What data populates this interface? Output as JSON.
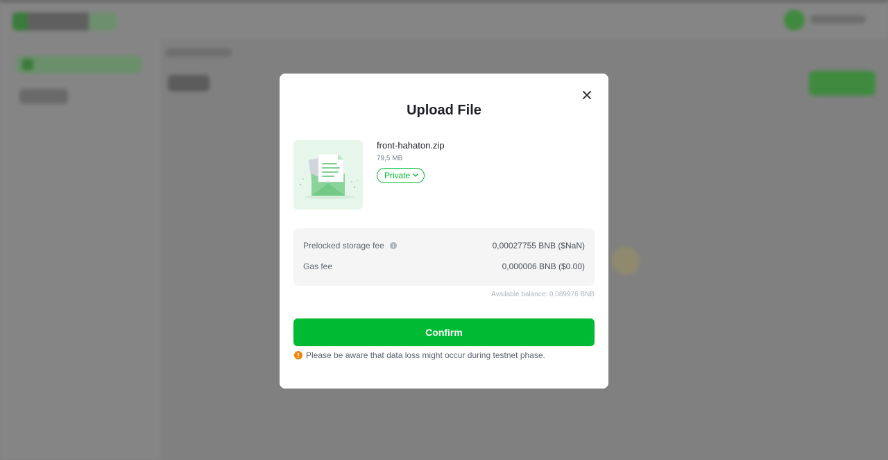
{
  "colors": {
    "accent": "#00ba34",
    "warning": "#f0850c",
    "thumb_bg": "#e7f6ea",
    "overlay": "#808080"
  },
  "modal": {
    "title": "Upload File",
    "close_icon": "close-icon",
    "file": {
      "name": "front-hahaton.zip",
      "size": "79,5 MB",
      "icon": "envelope-document-icon",
      "visibility": "Private"
    },
    "fees": [
      {
        "label": "Prelocked storage fee",
        "value": "0,00027755 BNB ($NaN)",
        "icon": "info-icon"
      },
      {
        "label": "Gas fee",
        "value": "0,000006 BNB ($0.00)"
      }
    ],
    "available_balance": "Available balance: 0,089976 BNB",
    "confirm_label": "Confirm",
    "warning_icon": "warning-icon",
    "warning_text": "Please be aware that data loss might occur during testnet phase."
  }
}
